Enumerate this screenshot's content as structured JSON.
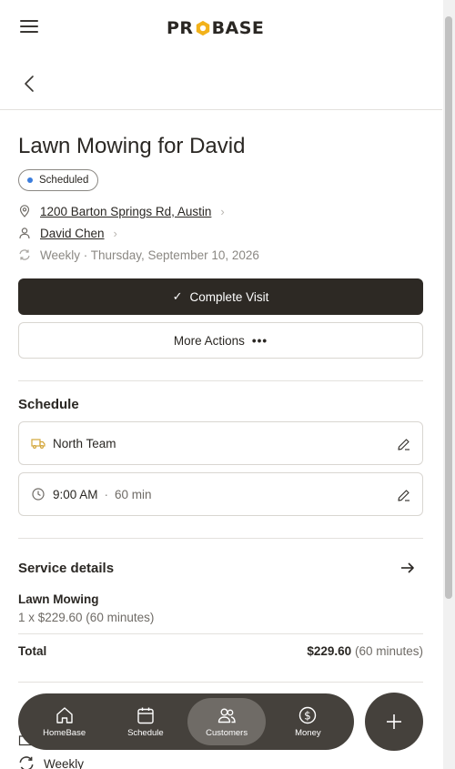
{
  "header": {
    "logo_left": "PR",
    "logo_right": "BASE"
  },
  "job": {
    "title": "Lawn Mowing for David",
    "status": "Scheduled",
    "address": "1200 Barton Springs Rd, Austin",
    "customer": "David Chen",
    "recurrence": "Weekly · Thursday, September 10, 2026"
  },
  "actions": {
    "complete_label": "Complete Visit",
    "more_label": "More Actions",
    "more_glyph": "•••"
  },
  "schedule": {
    "title": "Schedule",
    "team": "North Team",
    "time": "9:00 AM",
    "separator": "·",
    "duration": "60 min"
  },
  "service": {
    "title": "Service details",
    "name": "Lawn Mowing",
    "line": "1 x $229.60 (60 minutes)",
    "total_label": "Total",
    "total_amount": "$229.60",
    "total_duration": "(60 minutes)"
  },
  "peek": {
    "recurrence_label": "Weekly"
  },
  "nav": {
    "items": [
      {
        "label": "HomeBase"
      },
      {
        "label": "Schedule"
      },
      {
        "label": "Customers"
      },
      {
        "label": "Money"
      }
    ],
    "active": "Customers",
    "fab_label": "+"
  },
  "colors": {
    "primary_dark": "#2d2924",
    "nav_bg": "#45413c",
    "logo_accent": "#f2b21b",
    "status_dot": "#3b7ddd",
    "truck_icon": "#d3a63a"
  }
}
